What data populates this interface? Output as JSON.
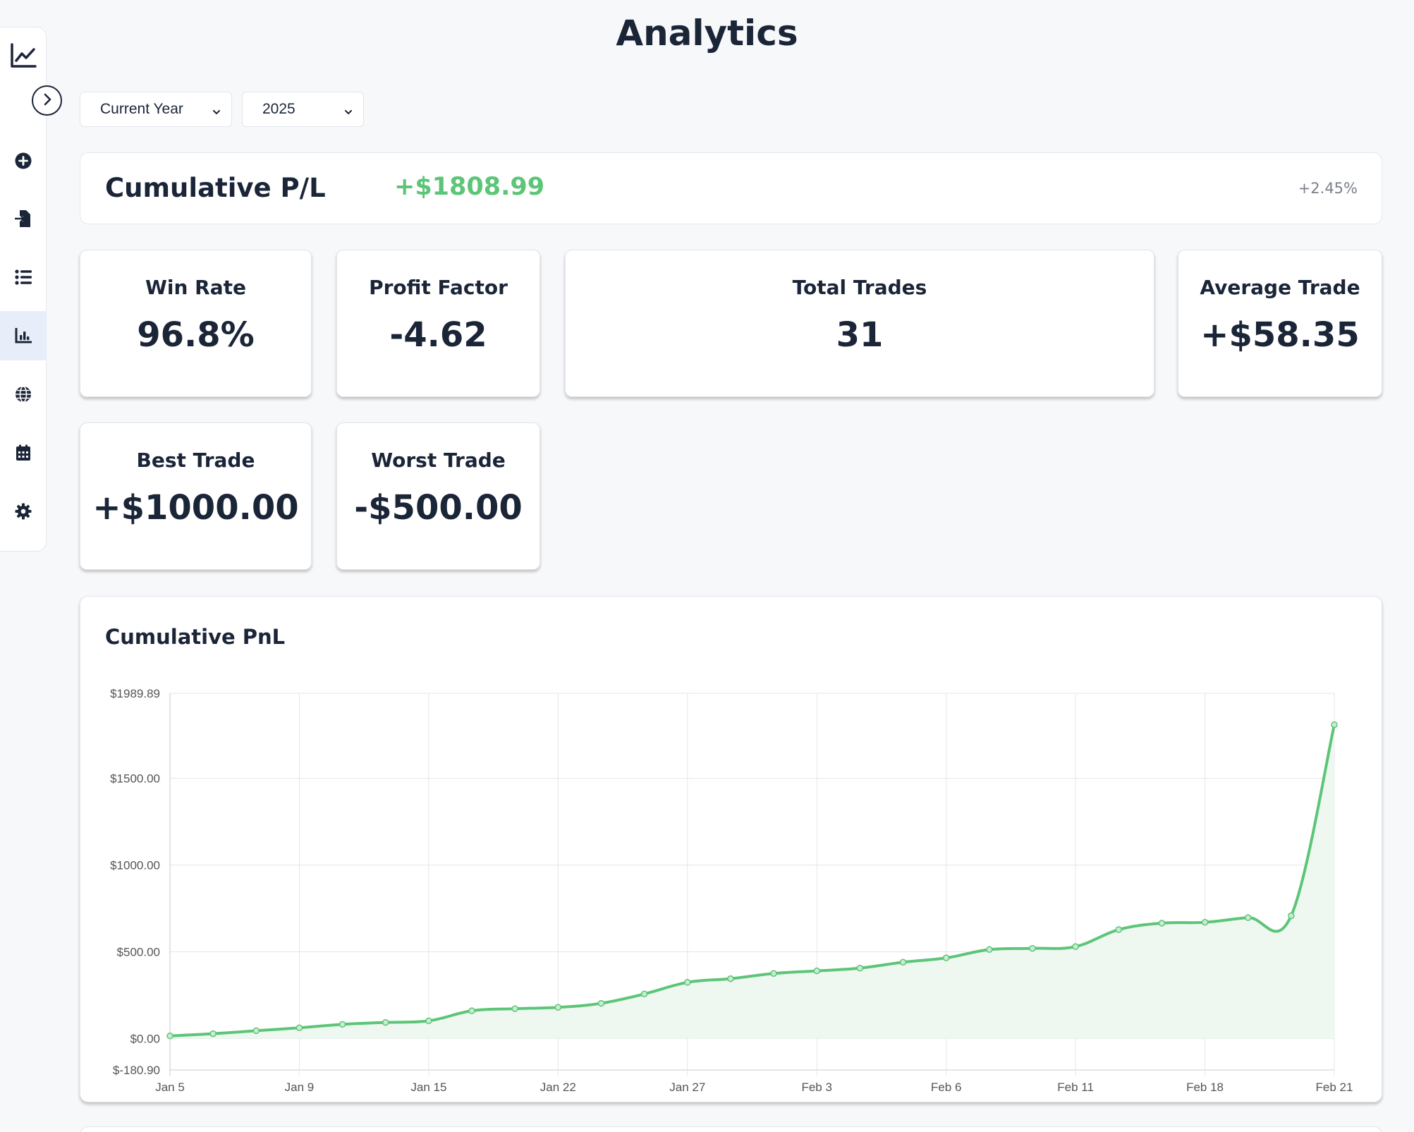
{
  "page": {
    "title": "Analytics"
  },
  "sidebar": {
    "logo_icon": "line-chart-icon",
    "toggle_icon": "chevron-right-icon",
    "items": [
      {
        "id": "add",
        "icon": "plus-circle-icon"
      },
      {
        "id": "import",
        "icon": "file-import-icon"
      },
      {
        "id": "trades",
        "icon": "list-icon"
      },
      {
        "id": "analytics",
        "icon": "bar-chart-icon",
        "active": true
      },
      {
        "id": "markets",
        "icon": "globe-icon"
      },
      {
        "id": "calendar",
        "icon": "calendar-icon"
      },
      {
        "id": "settings",
        "icon": "gear-icon"
      }
    ]
  },
  "filters": {
    "period": {
      "selected": "Current Year"
    },
    "year": {
      "selected": "2025"
    }
  },
  "cumulative": {
    "title": "Cumulative P/L",
    "value": "+$1808.99",
    "percent": "+2.45%",
    "value_color": "#5cc577"
  },
  "stats": {
    "win_rate": {
      "label": "Win Rate",
      "value": "96.8%"
    },
    "profit_factor": {
      "label": "Profit Factor",
      "value": "-4.62"
    },
    "total_trades": {
      "label": "Total Trades",
      "value": "31"
    },
    "average_trade": {
      "label": "Average Trade",
      "value": "+$58.35"
    },
    "best_trade": {
      "label": "Best Trade",
      "value": "+$1000.00"
    },
    "worst_trade": {
      "label": "Worst Trade",
      "value": "-$500.00"
    }
  },
  "chart": {
    "title": "Cumulative PnL"
  },
  "chart_data": {
    "type": "area",
    "title": "Cumulative PnL",
    "xlabel": "",
    "ylabel": "",
    "grid": true,
    "legend": "none",
    "color": "#5cc577",
    "fill": "#eef8f1",
    "ylim": [
      -180.9,
      1989.89
    ],
    "yticks": [
      1989.89,
      1500.0,
      1000.0,
      500.0,
      0.0,
      -180.9
    ],
    "ytick_labels": [
      "$1989.89",
      "$1500.00",
      "$1000.00",
      "$500.00",
      "$0.00",
      "$-180.90"
    ],
    "xtick_labels": [
      "Jan 5",
      "Jan 9",
      "Jan 15",
      "Jan 22",
      "Jan 27",
      "Feb 3",
      "Feb 6",
      "Feb 11",
      "Feb 18",
      "Feb 21"
    ],
    "values": [
      15,
      28,
      45,
      62,
      82,
      93,
      102,
      160,
      172,
      180,
      203,
      257,
      324,
      345,
      375,
      390,
      406,
      440,
      465,
      513,
      520,
      530,
      628,
      665,
      670,
      697,
      708,
      1808.99
    ]
  }
}
